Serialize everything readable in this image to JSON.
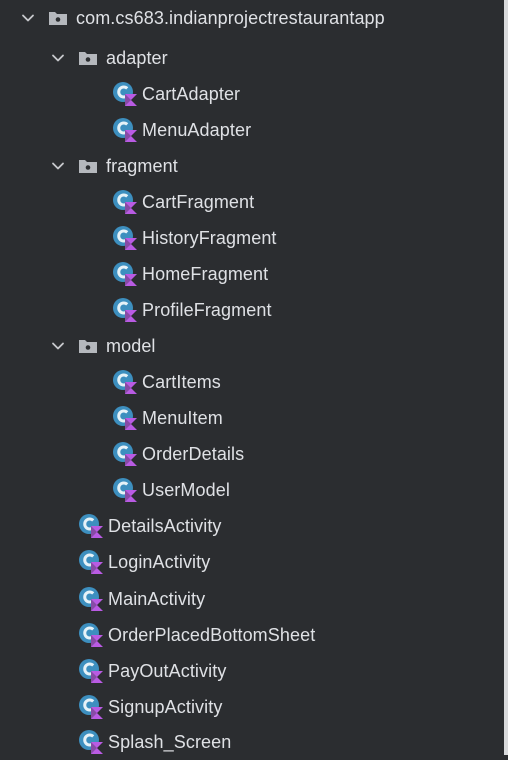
{
  "project_tree": {
    "root_package": "com.cs683.indianprojectrestaurantapp",
    "folders": [
      {
        "name": "adapter",
        "classes": [
          "CartAdapter",
          "MenuAdapter"
        ]
      },
      {
        "name": "fragment",
        "classes": [
          "CartFragment",
          "HistoryFragment",
          "HomeFragment",
          "ProfileFragment"
        ]
      },
      {
        "name": "model",
        "classes": [
          "CartItems",
          "MenuItem",
          "OrderDetails",
          "UserModel"
        ]
      }
    ],
    "root_classes": [
      "DetailsActivity",
      "LoginActivity",
      "MainActivity",
      "OrderPlacedBottomSheet",
      "PayOutActivity",
      "SignupActivity",
      "Splash_Screen"
    ]
  },
  "icons": {
    "expand": "chevron-down-icon",
    "package": "package-folder-icon",
    "kotlin_class": "kotlin-class-icon"
  },
  "colors": {
    "background": "#2b2d30",
    "text": "#dfe1e5",
    "folder_icon": "#b5b8bd",
    "class_icon": "#3d8fbf",
    "kotlin_badge": "#b95be3"
  }
}
